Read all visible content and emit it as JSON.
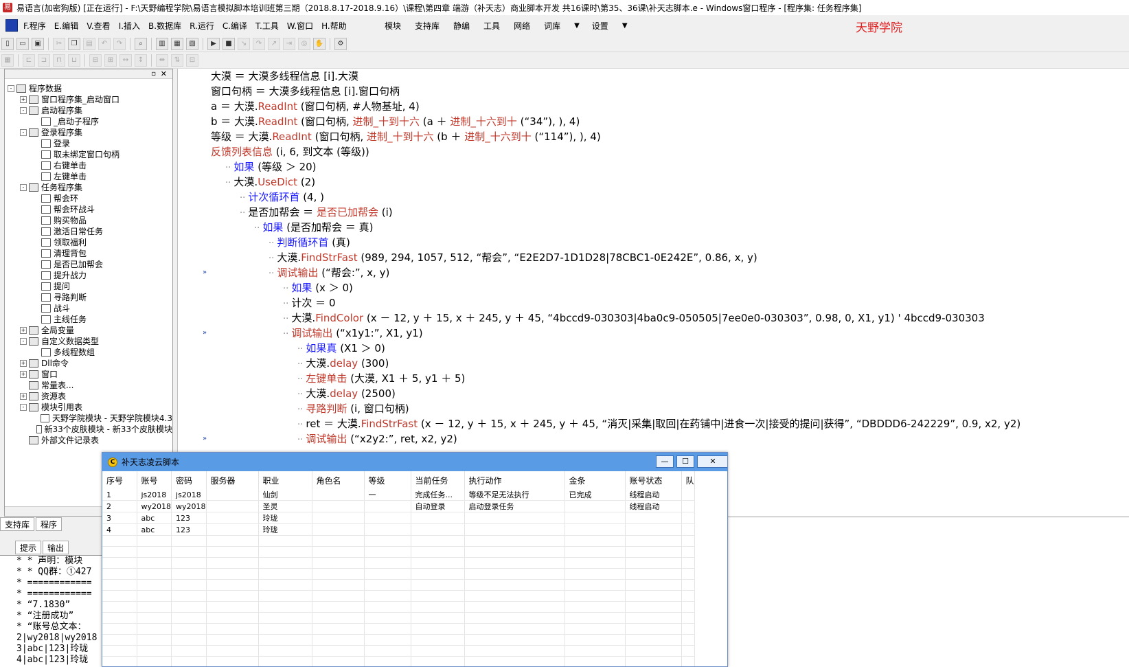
{
  "window": {
    "title": "易语言(加密狗版) [正在运行] - F:\\天野编程学院\\易语言模拟脚本培训班第三期（2018.8.17-2018.9.16）\\课程\\第四章 端游（补天志）商业脚本开发  共16课时\\第35、36课\\补天志脚本.e - Windows窗口程序 - [程序集: 任务程序集]"
  },
  "menu": {
    "items": [
      "F.程序",
      "E.编辑",
      "V.查看",
      "I.插入",
      "B.数据库",
      "R.运行",
      "C.编译",
      "T.工具",
      "W.窗口",
      "H.帮助"
    ],
    "right_items": [
      "模块",
      "支持库",
      "静编",
      "工具",
      "网络",
      "词库",
      "设置"
    ],
    "watermark": "天野学院"
  },
  "toolbar": {
    "row1_icons": [
      "new-file-icon",
      "open-folder-icon",
      "save-icon",
      "cut-icon",
      "copy-icon",
      "paste-icon",
      "undo-icon",
      "redo-icon",
      "find-icon",
      "layout-a-icon",
      "layout-b-icon",
      "layout-c-icon",
      "run-icon",
      "stop-icon",
      "step-into-icon",
      "step-over-icon",
      "step-out-icon",
      "run-to-cursor-icon",
      "watch-icon",
      "hand-icon",
      "debug-icon"
    ],
    "row2_icons": [
      "grid-icon",
      "align-left-icon",
      "align-right-icon",
      "align-top-icon",
      "align-bottom-icon",
      "center-h-icon",
      "center-v-icon",
      "same-width-icon",
      "same-height-icon",
      "spacing-icon",
      "order-icon",
      "lock-icon"
    ]
  },
  "left_panel": {
    "tree": [
      {
        "label": "程序数据",
        "level": 0,
        "expander": "-"
      },
      {
        "label": "窗口程序集_启动窗口",
        "level": 1,
        "expander": "+"
      },
      {
        "label": "启动程序集",
        "level": 1,
        "expander": "-"
      },
      {
        "label": "_启动子程序",
        "level": 2,
        "expander": ""
      },
      {
        "label": "登录程序集",
        "level": 1,
        "expander": "-"
      },
      {
        "label": "登录",
        "level": 2,
        "expander": ""
      },
      {
        "label": "取未绑定窗口句柄",
        "level": 2,
        "expander": ""
      },
      {
        "label": "右键单击",
        "level": 2,
        "expander": ""
      },
      {
        "label": "左键单击",
        "level": 2,
        "expander": ""
      },
      {
        "label": "任务程序集",
        "level": 1,
        "expander": "-"
      },
      {
        "label": "帮会环",
        "level": 2,
        "expander": ""
      },
      {
        "label": "帮会环战斗",
        "level": 2,
        "expander": ""
      },
      {
        "label": "购买物品",
        "level": 2,
        "expander": ""
      },
      {
        "label": "激活日常任务",
        "level": 2,
        "expander": ""
      },
      {
        "label": "领取福利",
        "level": 2,
        "expander": ""
      },
      {
        "label": "清理背包",
        "level": 2,
        "expander": ""
      },
      {
        "label": "是否已加帮会",
        "level": 2,
        "expander": ""
      },
      {
        "label": "提升战力",
        "level": 2,
        "expander": ""
      },
      {
        "label": "提问",
        "level": 2,
        "expander": ""
      },
      {
        "label": "寻路判断",
        "level": 2,
        "expander": ""
      },
      {
        "label": "战斗",
        "level": 2,
        "expander": ""
      },
      {
        "label": "主线任务",
        "level": 2,
        "expander": ""
      },
      {
        "label": "全局变量",
        "level": 1,
        "expander": "+"
      },
      {
        "label": "自定义数据类型",
        "level": 1,
        "expander": "-"
      },
      {
        "label": "多线程数组",
        "level": 2,
        "expander": ""
      },
      {
        "label": "Dll命令",
        "level": 1,
        "expander": "+"
      },
      {
        "label": "窗口",
        "level": 1,
        "expander": "+"
      },
      {
        "label": "常量表...",
        "level": 1,
        "expander": ""
      },
      {
        "label": "资源表",
        "level": 1,
        "expander": "+"
      },
      {
        "label": "模块引用表",
        "level": 1,
        "expander": "-"
      },
      {
        "label": "天野学院模块 - 天野学院模块4.3",
        "level": 2,
        "expander": ""
      },
      {
        "label": "新33个皮肤模块 - 新33个皮肤模块",
        "level": 2,
        "expander": ""
      },
      {
        "label": "外部文件记录表",
        "level": 1,
        "expander": ""
      }
    ]
  },
  "bottom_tabs": [
    "支持库",
    "程序"
  ],
  "output_tabs": [
    "提示",
    "输出"
  ],
  "output_lines": [
    "* *  声明：模块",
    "* *  QQ群：①427",
    "* ============",
    "* ============",
    "*  “7.1830”",
    "*  “注册成功”",
    "*  “账号总文本：",
    "2|wy2018|wy2018",
    "3|abc|123|玲珑",
    "4|abc|123|玲珑"
  ],
  "code": {
    "lines": [
      {
        "indent": 0,
        "parts": [
          [
            "大漠 ＝ 大漠多线程信息 [i].大漠",
            ""
          ]
        ]
      },
      {
        "indent": 0,
        "parts": [
          [
            "窗口句柄 ＝ 大漠多线程信息 [i].窗口句柄",
            ""
          ]
        ]
      },
      {
        "indent": 0,
        "parts": [
          [
            "a ＝ 大漠.",
            ""
          ],
          [
            "ReadInt",
            "fn"
          ],
          [
            " (窗口句柄, #人物基址, 4)",
            ""
          ]
        ]
      },
      {
        "indent": 0,
        "parts": [
          [
            "b ＝ 大漠.",
            ""
          ],
          [
            "ReadInt",
            "fn"
          ],
          [
            " (窗口句柄, ",
            ""
          ],
          [
            "进制_十到十六",
            "fn"
          ],
          [
            " (a ＋ ",
            ""
          ],
          [
            "进制_十六到十",
            "fn"
          ],
          [
            " (“34”), ), 4)",
            ""
          ]
        ]
      },
      {
        "indent": 0,
        "parts": [
          [
            "等级 ＝ 大漠.",
            ""
          ],
          [
            "ReadInt",
            "fn"
          ],
          [
            " (窗口句柄, ",
            ""
          ],
          [
            "进制_十到十六",
            "fn"
          ],
          [
            " (b ＋ ",
            ""
          ],
          [
            "进制_十六到十",
            "fn"
          ],
          [
            " (“114”), ), 4)",
            ""
          ]
        ]
      },
      {
        "indent": 0,
        "parts": [
          [
            "反馈列表信息",
            "fn"
          ],
          [
            " (i, 6, 到文本 (等级))",
            ""
          ]
        ]
      },
      {
        "indent": 1,
        "parts": [
          [
            "如果",
            "kw"
          ],
          [
            " (等级 ＞ 20)",
            ""
          ]
        ]
      },
      {
        "indent": 1,
        "parts": [
          [
            "大漠.",
            ""
          ],
          [
            "UseDict",
            "fn"
          ],
          [
            " (2)",
            ""
          ]
        ]
      },
      {
        "indent": 2,
        "parts": [
          [
            "计次循环首",
            "kw"
          ],
          [
            " (4, )",
            ""
          ]
        ]
      },
      {
        "indent": 2,
        "parts": [
          [
            "是否加帮会 ＝ ",
            ""
          ],
          [
            "是否已加帮会",
            "fn"
          ],
          [
            " (i)",
            ""
          ]
        ]
      },
      {
        "indent": 3,
        "parts": [
          [
            "如果",
            "kw"
          ],
          [
            " (是否加帮会 ＝ 真)",
            ""
          ]
        ]
      },
      {
        "indent": 4,
        "parts": [
          [
            "判断循环首",
            "kw"
          ],
          [
            " (真)",
            ""
          ]
        ]
      },
      {
        "indent": 4,
        "parts": [
          [
            "大漠.",
            ""
          ],
          [
            "FindStrFast",
            "fn"
          ],
          [
            " (989, 294, 1057, 512, “帮会”, “E2E2D7-1D1D28|78CBC1-0E242E”, 0.86, x, y)",
            ""
          ]
        ]
      },
      {
        "indent": 4,
        "parts": [
          [
            "调试输出",
            "fn"
          ],
          [
            " (“帮会:”, x, y)",
            ""
          ]
        ]
      },
      {
        "indent": 5,
        "parts": [
          [
            "如果",
            "kw"
          ],
          [
            " (x ＞ 0)",
            ""
          ]
        ]
      },
      {
        "indent": 5,
        "parts": [
          [
            "计次 ＝ 0",
            ""
          ]
        ]
      },
      {
        "indent": 5,
        "parts": [
          [
            "大漠.",
            ""
          ],
          [
            "FindColor",
            "fn"
          ],
          [
            " (x － 12, y ＋ 15, x ＋ 245, y ＋ 45, “4bccd9-030303|4ba0c9-050505|7ee0e0-030303”, 0.98, 0, X1, y1)  ' 4bccd9-030303",
            ""
          ]
        ]
      },
      {
        "indent": 5,
        "parts": [
          [
            "调试输出",
            "fn"
          ],
          [
            " (“x1y1:”, X1, y1)",
            ""
          ]
        ]
      },
      {
        "indent": 6,
        "parts": [
          [
            "如果真",
            "kw"
          ],
          [
            " (X1 ＞ 0)",
            ""
          ]
        ]
      },
      {
        "indent": 6,
        "parts": [
          [
            "大漠.",
            ""
          ],
          [
            "delay",
            "fn"
          ],
          [
            " (300)",
            ""
          ]
        ]
      },
      {
        "indent": 6,
        "parts": [
          [
            "左键单击",
            "fn"
          ],
          [
            " (大漠, X1 ＋ 5, y1 ＋ 5)",
            ""
          ]
        ]
      },
      {
        "indent": 6,
        "parts": [
          [
            "大漠.",
            ""
          ],
          [
            "delay",
            "fn"
          ],
          [
            " (2500)",
            ""
          ]
        ]
      },
      {
        "indent": 6,
        "parts": [
          [
            "寻路判断",
            "fn"
          ],
          [
            " (i, 窗口句柄)",
            ""
          ]
        ]
      },
      {
        "indent": 6,
        "parts": [
          [
            "ret ＝ 大漠.",
            ""
          ],
          [
            "FindStrFast",
            "fn"
          ],
          [
            " (x － 12, y ＋ 15, x ＋ 245, y ＋ 45, “消灭|采集|取回|在药铺中|进食一次|接受的提问|获得”, “DBDDD6-242229”, 0.9, x2, y2)",
            ""
          ]
        ]
      },
      {
        "indent": 6,
        "parts": [
          [
            "调试输出",
            "fn"
          ],
          [
            " (“x2y2:”, ret, x2, y2)",
            ""
          ]
        ]
      }
    ]
  },
  "dialog": {
    "title": "补天志凌云脚本",
    "columns": [
      "序号",
      "账号",
      "密码",
      "服务器",
      "职业",
      "角色名",
      "等级",
      "当前任务",
      "执行动作",
      "金条",
      "账号状态",
      "队"
    ],
    "rows": [
      [
        "1",
        "js2018",
        "js2018",
        "",
        "仙剑",
        "",
        "一",
        "完成任务...",
        "等级不足无法执行",
        "已完成",
        "线程启动",
        ""
      ],
      [
        "2",
        "wy2018",
        "wy2018",
        "",
        "圣灵",
        "",
        "",
        "自动登录",
        "启动登录任务",
        "",
        "线程启动",
        ""
      ],
      [
        "3",
        "abc",
        "123",
        "",
        "玲珑",
        "",
        "",
        "",
        "",
        "",
        "",
        ""
      ],
      [
        "4",
        "abc",
        "123",
        "",
        "玲珑",
        "",
        "",
        "",
        "",
        "",
        "",
        ""
      ]
    ]
  }
}
